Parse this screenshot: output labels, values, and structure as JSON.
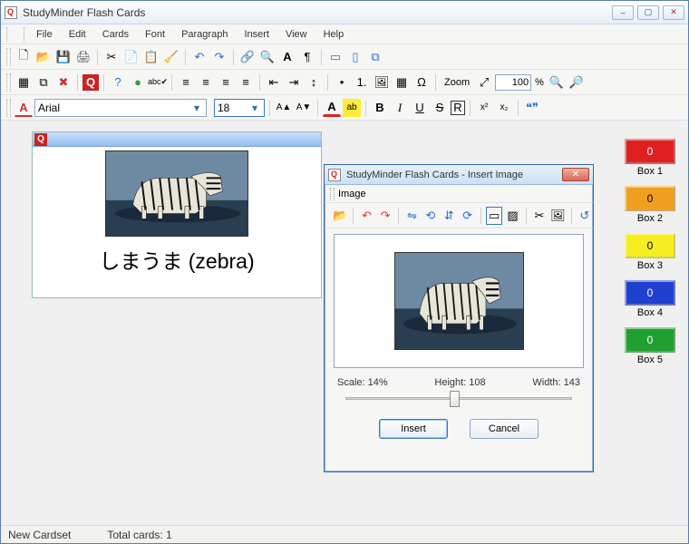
{
  "title": "StudyMinder Flash Cards",
  "window_buttons": {
    "minimize": "–",
    "maximize": "▢",
    "close": "✕"
  },
  "menu": [
    "File",
    "Edit",
    "Cards",
    "Font",
    "Paragraph",
    "Insert",
    "View",
    "Help"
  ],
  "toolbar1": {
    "new": "🗋",
    "open": "📂",
    "save": "💾",
    "print": "🖨",
    "cut": "✂",
    "copy": "📄",
    "paste": "📋",
    "format_paint": "🧹",
    "undo": "↶",
    "redo": "↷",
    "hyperlink": "🔗",
    "find": "🔍",
    "font_dlg": "A",
    "para_dlg": "¶",
    "layout1": "▭",
    "layout2": "▯",
    "layout3": "⧉"
  },
  "toolbar2": {
    "card_new": "▦",
    "card_dup": "⧉",
    "card_del": "✖",
    "qmark": "Q",
    "help": "?",
    "ball": "●",
    "spell": "abc✔",
    "align_left": "≡",
    "align_center": "≡",
    "align_right": "≡",
    "align_just": "≡",
    "indent_dec": "⇤",
    "indent_inc": "⇥",
    "linesp": "↕",
    "bullets": "•",
    "numbers": "1.",
    "image": "🖼",
    "table": "▦",
    "symbol": "Ω",
    "zoom_label": "Zoom",
    "zoom_fit": "⤢",
    "zoom_value": "100",
    "zoom_pct": "%",
    "zoom_in": "🔍",
    "zoom_out": "🔎"
  },
  "toolbar3": {
    "fontcolor": "A",
    "fontname": "Arial",
    "fontsize": "18",
    "grow": "A▲",
    "shrink": "A▼",
    "color": "A",
    "hilite": "ab",
    "bold": "B",
    "italic": "I",
    "underline": "U",
    "strike": "S",
    "box": "R",
    "sup": "x²",
    "sub": "x₂",
    "quotes": "❝❞"
  },
  "card": {
    "caption": "しまうま (zebra)"
  },
  "boxes": [
    {
      "label": "Box 1",
      "count": "0",
      "color": "#e02020",
      "text": "inv"
    },
    {
      "label": "Box 2",
      "count": "0",
      "color": "#f0a020",
      "text": ""
    },
    {
      "label": "Box 3",
      "count": "0",
      "color": "#f6ee20",
      "text": ""
    },
    {
      "label": "Box 4",
      "count": "0",
      "color": "#2040d0",
      "text": "inv"
    },
    {
      "label": "Box 5",
      "count": "0",
      "color": "#20a030",
      "text": "inv"
    }
  ],
  "status": {
    "left": "New Cardset",
    "total": "Total cards: 1"
  },
  "dialog": {
    "title": "StudyMinder Flash Cards - Insert Image",
    "menu": "Image",
    "tools": {
      "open": "📂",
      "undo": "↶",
      "redo": "↷",
      "fliph": "⇋",
      "rotl": "⟲",
      "flipv": "⇵",
      "rotr": "⟳",
      "border": "▭",
      "shadow": "▨",
      "crop": "✂",
      "adjust": "🖼",
      "reset": "↺"
    },
    "scale_label": "Scale: 14%",
    "height_label": "Height: 108",
    "width_label": "Width: 143",
    "insert": "Insert",
    "cancel": "Cancel"
  }
}
